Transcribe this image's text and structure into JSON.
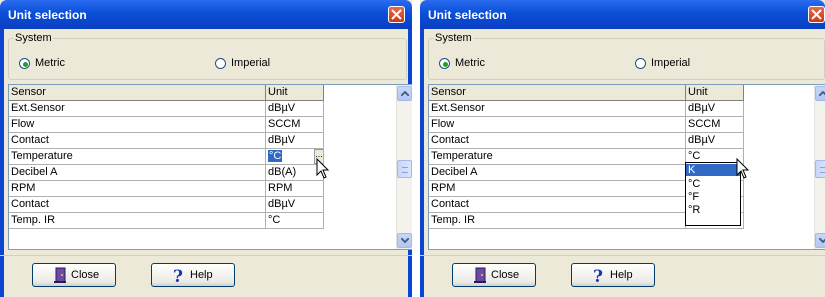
{
  "window_title": "Unit selection",
  "system_group_label": "System",
  "radio_metric": "Metric",
  "radio_imperial": "Imperial",
  "columns": {
    "sensor": "Sensor",
    "unit": "Unit"
  },
  "rows": [
    {
      "sensor": "Ext.Sensor",
      "unit": "dBµV"
    },
    {
      "sensor": "Flow",
      "unit": "SCCM"
    },
    {
      "sensor": "Contact",
      "unit": "dBµV"
    },
    {
      "sensor": "Temperature",
      "unit": "°C"
    },
    {
      "sensor": "Decibel A",
      "unit": "dB(A)"
    },
    {
      "sensor": "RPM",
      "unit": "RPM"
    },
    {
      "sensor": "Contact",
      "unit": "dBµV"
    },
    {
      "sensor": "Temp. IR",
      "unit": "°C"
    }
  ],
  "ellipsis_label": "...",
  "dropdown_options": [
    "K",
    "°C",
    "°F",
    "°R"
  ],
  "dropdown_selected": "K",
  "buttons": {
    "close": "Close",
    "help": "Help"
  },
  "colors": {
    "titlebar": "#0a4fd7",
    "selection": "#316ac5",
    "radio_dot": "#21a121"
  },
  "icons": {
    "close_button": "door-icon",
    "help_button": "question-icon"
  }
}
